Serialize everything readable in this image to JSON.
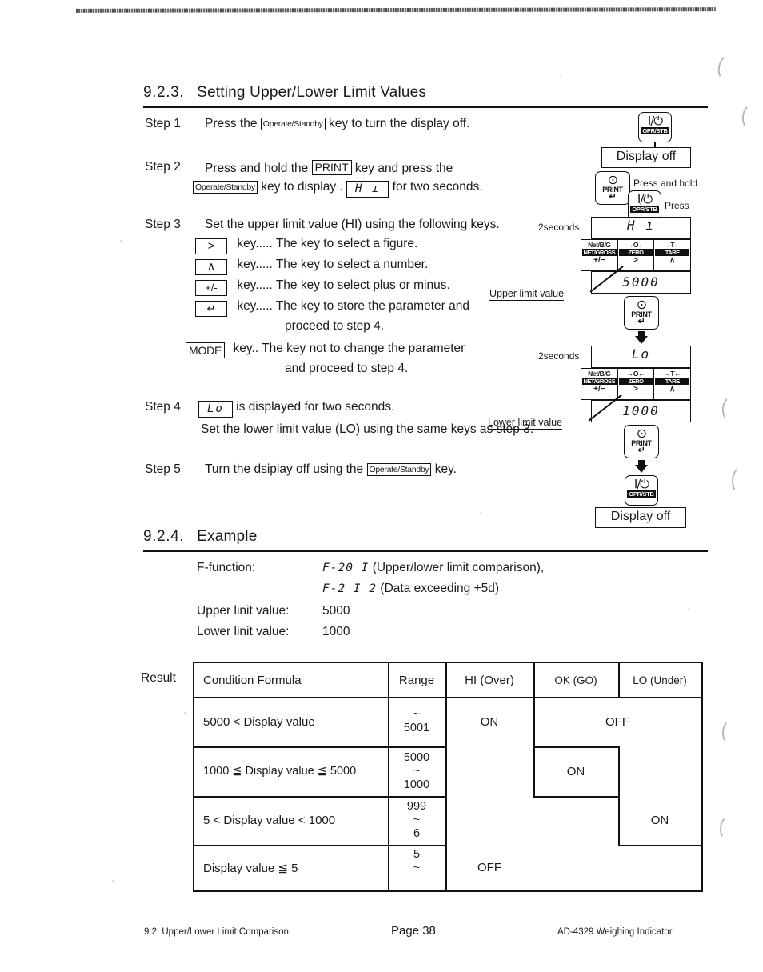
{
  "page": {
    "footer_left": "9.2. Upper/Lower Limit Comparison",
    "footer_center": "Page 38",
    "footer_right": "AD-4329 Weighing Indicator"
  },
  "section_923": {
    "number": "9.2.3.",
    "title": "Setting Upper/Lower Limit Values",
    "steps": [
      {
        "label": "Step 1",
        "before": "Press the",
        "key": "Operate/Standby",
        "after": "key to turn the display off."
      },
      {
        "label": "Step 2",
        "line1_before": "Press and hold the",
        "line1_key": "PRINT",
        "line1_after": "key and press the",
        "line2_key": "Operate/Standby",
        "line2_mid": "key to display .",
        "line2_display": "H ı",
        "line2_after": "for two seconds."
      },
      {
        "label": "Step 3",
        "intro": "Set the upper limit value (HI) using the following keys.",
        "keys": [
          {
            "cap": ">",
            "desc": "key..... The key to select a figure."
          },
          {
            "cap": "∧",
            "desc": "key..... The key to select a number."
          },
          {
            "cap": "+/-",
            "desc": "key..... The key to select plus or minus."
          },
          {
            "cap": "↵",
            "desc": "key..... The key to store the parameter and",
            "desc2": "proceed to step 4."
          },
          {
            "cap": "MODE",
            "desc": "key.. The key not to change the parameter",
            "desc2": "and proceed to step 4."
          }
        ]
      },
      {
        "label": "Step 4",
        "display": "Lo",
        "line1_after": "is displayed for two seconds.",
        "line2": "Set the lower limit value (LO) using the same keys as step 3."
      },
      {
        "label": "Step 5",
        "before": "Turn the dsiplay off using the",
        "key": "Operate/Standby",
        "after": "key."
      }
    ]
  },
  "diagram": {
    "power_key": {
      "glyph": "I/⏻",
      "caption": "OPR/STB"
    },
    "print_key": {
      "glyph": "⊙",
      "caption": "PRINT",
      "arrow": "↵"
    },
    "display_off_1": "Display off",
    "display_off_2": "Display off",
    "press_and_hold": "Press and hold",
    "press": "Press",
    "seconds_1": "2seconds",
    "seconds_2": "2seconds",
    "hi_display": "H ı",
    "lo_display": "Lo",
    "upper_value": "5000",
    "lower_value": "1000",
    "upper_label": "Upper limit value",
    "lower_label": "Lower limit value",
    "key_row": [
      {
        "l1": "Net/B/G",
        "l2": "NET/GROSS",
        "l3": "+/−"
      },
      {
        "l1": "→O←",
        "l2": "ZERO",
        "l3": ">"
      },
      {
        "l1": "→T←",
        "l2": "TARE",
        "l3": "∧"
      }
    ]
  },
  "section_924": {
    "number": "9.2.4.",
    "title": "Example",
    "rows": [
      {
        "label": "F-function:",
        "code": "F-20  I",
        "note": "(Upper/lower limit comparison),"
      },
      {
        "label": "",
        "code": "F-2 I  2",
        "note": "(Data exceeding +5d)"
      },
      {
        "label": "Upper linit value:",
        "code": "",
        "note": "5000"
      },
      {
        "label": "Lower linit value:",
        "code": "",
        "note": "1000"
      }
    ]
  },
  "result_table": {
    "label": "Result",
    "headers": [
      "Condition Formula",
      "Range",
      "HI (Over)",
      "OK (GO)",
      "LO (Under)"
    ],
    "rows": [
      {
        "formula": "5000 < Display value",
        "range": [
          "",
          "~",
          "5001"
        ],
        "hi": "ON",
        "ok": "",
        "lo": "OFF"
      },
      {
        "formula": "1000 ≦ Display value ≦ 5000",
        "range": [
          "5000",
          "~",
          "1000"
        ],
        "hi": "",
        "ok": "ON",
        "lo": ""
      },
      {
        "formula": "5 < Display value < 1000",
        "range": [
          "999",
          "~",
          "6"
        ],
        "hi": "",
        "ok": "",
        "lo": "ON"
      },
      {
        "formula": "Display value ≦ 5",
        "range": [
          "5",
          "~",
          ""
        ],
        "hi": "OFF",
        "ok": "",
        "lo": ""
      }
    ]
  }
}
